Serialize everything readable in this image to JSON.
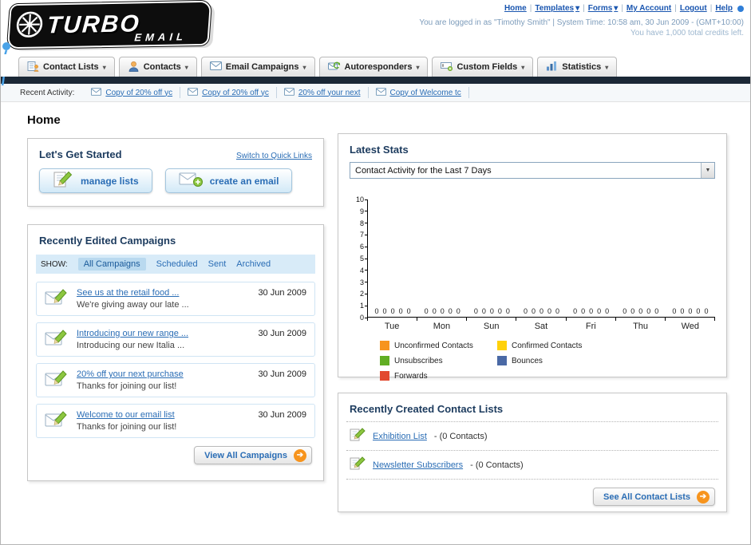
{
  "header": {
    "logo": {
      "line1": "TURBO",
      "line2": "EMAIL"
    },
    "nav": {
      "home": "Home",
      "templates": "Templates",
      "forms": "Forms",
      "my_account": "My Account",
      "logout": "Logout",
      "help": "Help"
    },
    "login_info": "You are logged in as \"Timothy Smith\" | System Time: 10:58 am, 30 Jun 2009 - (GMT+10:00)",
    "credits_info": "You have 1,000 total credits left."
  },
  "nav_tabs": [
    {
      "label": "Contact Lists"
    },
    {
      "label": "Contacts"
    },
    {
      "label": "Email Campaigns"
    },
    {
      "label": "Autoresponders"
    },
    {
      "label": "Custom Fields"
    },
    {
      "label": "Statistics"
    }
  ],
  "recent_activity": {
    "label": "Recent Activity:",
    "items": [
      {
        "label": "Copy of 20% off yc"
      },
      {
        "label": "Copy of 20% off yc"
      },
      {
        "label": "20% off your next"
      },
      {
        "label": "Copy of Welcome tc"
      }
    ]
  },
  "page": {
    "title": "Home"
  },
  "get_started": {
    "title": "Let's Get Started",
    "switch_link": "Switch to Quick Links",
    "manage_lists_button": "manage lists",
    "create_email_button": "create an email"
  },
  "campaigns": {
    "title": "Recently Edited Campaigns",
    "show_label": "SHOW:",
    "filters": [
      {
        "label": "All Campaigns",
        "active": true
      },
      {
        "label": "Scheduled",
        "active": false
      },
      {
        "label": "Sent",
        "active": false
      },
      {
        "label": "Archived",
        "active": false
      }
    ],
    "items": [
      {
        "title": "See us at the retail food ...",
        "subtitle": "We're giving away our late ...",
        "date": "30 Jun 2009"
      },
      {
        "title": "Introducing our new range ...",
        "subtitle": "Introducing our new Italia ...",
        "date": "30 Jun 2009"
      },
      {
        "title": "20% off your next purchase",
        "subtitle": "Thanks for joining our list!",
        "date": "30 Jun 2009"
      },
      {
        "title": "Welcome to our email list",
        "subtitle": "Thanks for joining our list!",
        "date": "30 Jun 2009"
      }
    ],
    "view_all_button": "View All Campaigns"
  },
  "stats": {
    "title": "Latest Stats",
    "selected_option": "Contact Activity for the Last 7 Days",
    "chart_data": {
      "type": "bar",
      "categories": [
        "Tue",
        "Mon",
        "Sun",
        "Sat",
        "Fri",
        "Thu",
        "Wed"
      ],
      "series": [
        {
          "name": "Unconfirmed Contacts",
          "color": "#f7941d",
          "values": [
            0,
            0,
            0,
            0,
            0,
            0,
            0
          ]
        },
        {
          "name": "Confirmed Contacts",
          "color": "#ffd10a",
          "values": [
            0,
            0,
            0,
            0,
            0,
            0,
            0
          ]
        },
        {
          "name": "Unsubscribes",
          "color": "#61ae24",
          "values": [
            0,
            0,
            0,
            0,
            0,
            0,
            0
          ]
        },
        {
          "name": "Bounces",
          "color": "#4a69a5",
          "values": [
            0,
            0,
            0,
            0,
            0,
            0,
            0
          ]
        },
        {
          "name": "Forwards",
          "color": "#e2492f",
          "values": [
            0,
            0,
            0,
            0,
            0,
            0,
            0
          ]
        }
      ],
      "ylim": [
        0,
        10
      ],
      "y_step": 1,
      "grid": false,
      "legend_position": "bottom"
    }
  },
  "contact_lists": {
    "title": "Recently Created Contact Lists",
    "items": [
      {
        "name": "Exhibition List",
        "suffix": "- (0 Contacts)"
      },
      {
        "name": "Newsletter Subscribers",
        "suffix": "- (0 Contacts)"
      }
    ],
    "see_all_button": "See All Contact Lists"
  }
}
